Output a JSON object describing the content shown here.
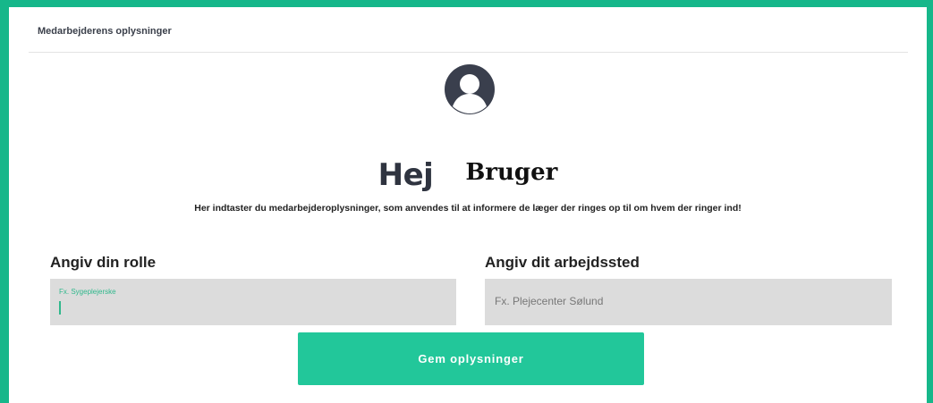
{
  "panel": {
    "title": "Medarbejderens oplysninger"
  },
  "greeting": {
    "hello": "Hej",
    "name": "Bruger"
  },
  "intro": "Her indtaster du medarbejderoplysninger, som anvendes til at informere de læger der ringes op til om hvem der ringer ind!",
  "fields": {
    "role": {
      "label": "Angiv din rolle",
      "placeholder": "Fx. Sygeplejerske",
      "value": ""
    },
    "workplace": {
      "label": "Angiv dit arbejdssted",
      "placeholder": "Fx. Plejecenter Sølund",
      "value": ""
    }
  },
  "save_button": "Gem oplysninger",
  "icons": {
    "avatar": "user-avatar-icon"
  },
  "colors": {
    "accent": "#22c79a",
    "frame": "#16b78a",
    "input_bg": "#dcdcdc",
    "avatar": "#3a3f4d"
  }
}
